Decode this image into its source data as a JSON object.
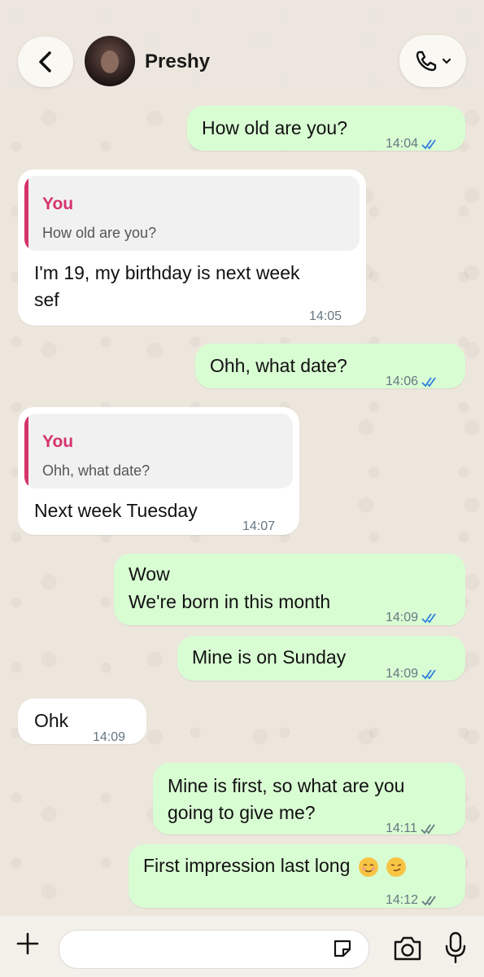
{
  "header": {
    "contact_name": "Preshy",
    "back_icon": "chevron-left-icon",
    "call_icon": "phone-icon"
  },
  "messages": [
    {
      "dir": "out",
      "text": "How old are you?",
      "time": "14:04",
      "ticks": "read"
    },
    {
      "dir": "in",
      "quote_author": "You",
      "quote_text": "How old are you?",
      "text_line1": "I'm 19, my birthday is next week",
      "text_line2": "sef",
      "time": "14:05"
    },
    {
      "dir": "out",
      "text": "Ohh, what date?",
      "time": "14:06",
      "ticks": "read"
    },
    {
      "dir": "in",
      "quote_author": "You",
      "quote_text": "Ohh, what date?",
      "text": "Next week Tuesday",
      "time": "14:07"
    },
    {
      "dir": "out",
      "text_line1": "Wow",
      "text_line2": "We're born in this month",
      "time": "14:09",
      "ticks": "read"
    },
    {
      "dir": "out",
      "text": "Mine is on Sunday",
      "time": "14:09",
      "ticks": "read"
    },
    {
      "dir": "in",
      "text": "Ohk",
      "time": "14:09"
    },
    {
      "dir": "out",
      "text_line1": "Mine is first, so what are you",
      "text_line2": "going to give me?",
      "time": "14:11",
      "ticks": "delivered"
    },
    {
      "dir": "out",
      "text": "First impression last long",
      "emojis": [
        "relieved-face-emoji",
        "smirking-face-emoji"
      ],
      "time": "14:12",
      "ticks": "delivered"
    }
  ],
  "input": {
    "placeholder": "",
    "icons": [
      "plus-icon",
      "sticker-icon",
      "camera-icon",
      "microphone-icon"
    ]
  },
  "colors": {
    "outgoing_bubble": "#d9fdd3",
    "incoming_bubble": "#ffffff",
    "read_ticks": "#2f7de1",
    "quote_accent": "#d6336c",
    "chat_background": "#ece6dd"
  }
}
